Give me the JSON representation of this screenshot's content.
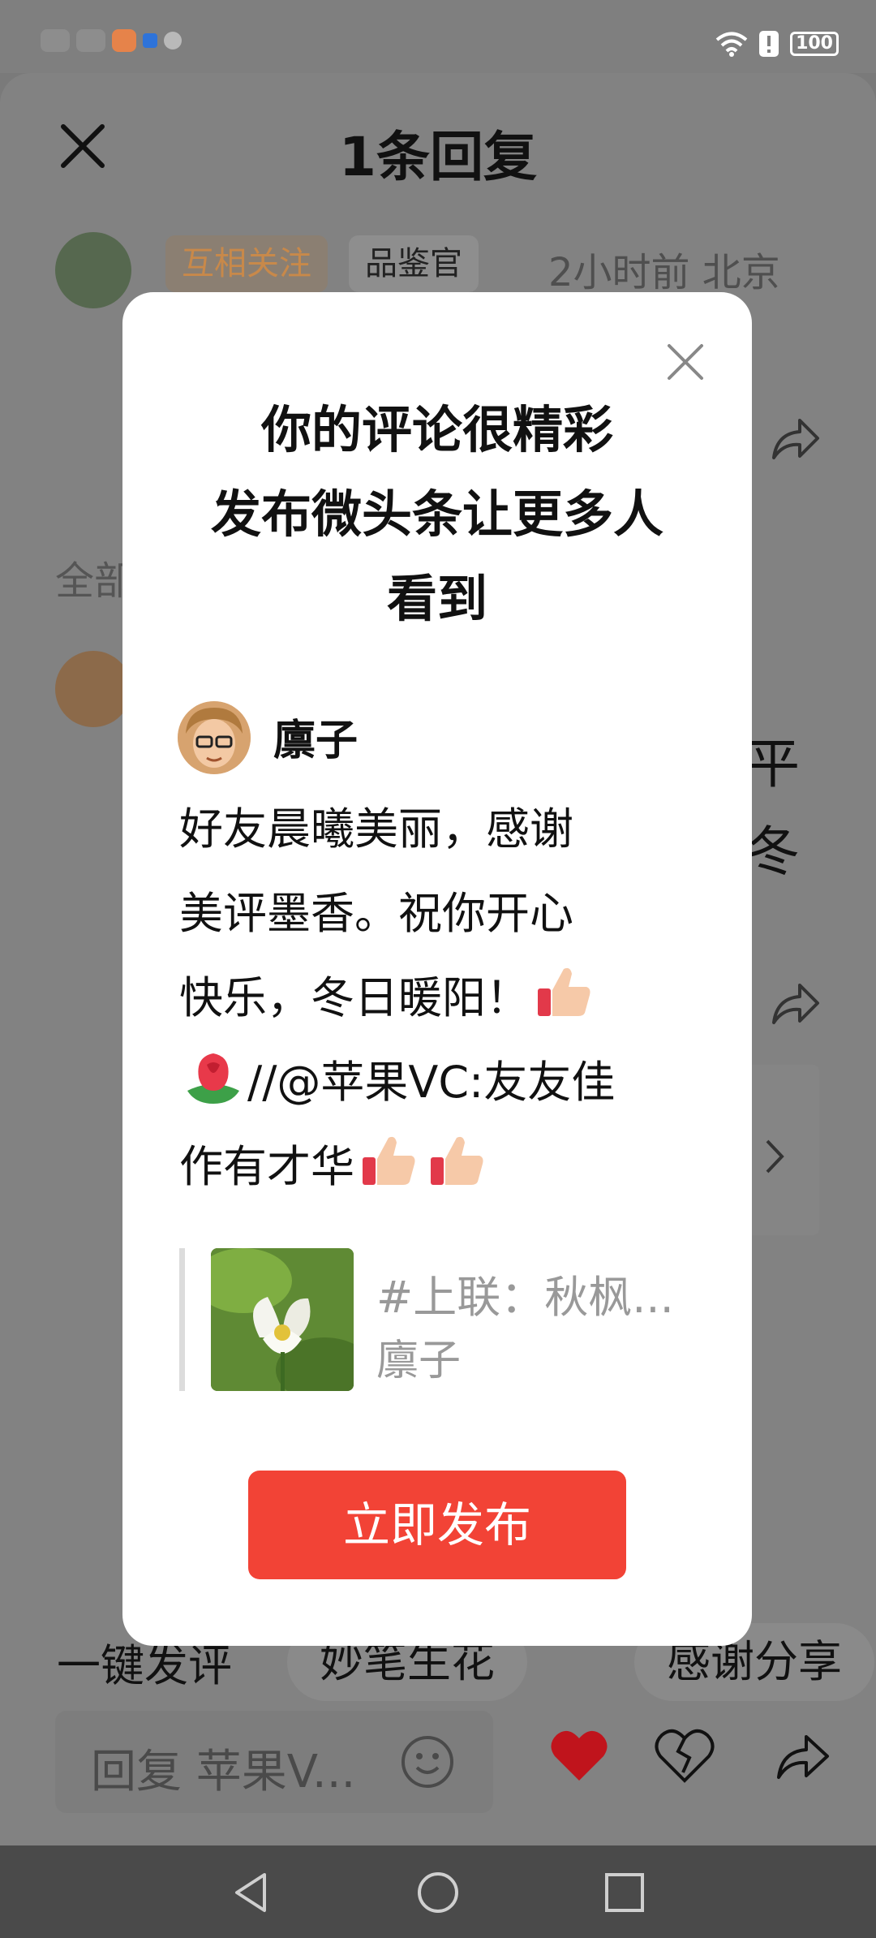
{
  "status_bar": {
    "battery": "100"
  },
  "sheet": {
    "title": "1条回复",
    "tags": [
      "互相关注",
      "品鉴官"
    ],
    "meta": "2小时前 北京",
    "all_label": "全部",
    "right_fragments": [
      "平",
      "冬"
    ]
  },
  "quick_chips": {
    "one_click": "一键发评",
    "chip1": "妙笔生花",
    "chip2": "感谢分享"
  },
  "bottom_bar": {
    "reply_placeholder": "回复 苹果V..."
  },
  "modal": {
    "title_lines": [
      "你的评论很精彩",
      "发布微头条让更多人",
      "看到"
    ],
    "author": "廪子",
    "body": {
      "line1": "好友晨曦美丽，感谢",
      "line2": "美评墨香。祝你开心",
      "line3": "快乐，冬日暖阳！",
      "line4": "//@苹果VC:友友佳",
      "line5": "作有才华"
    },
    "quote_title": "#上联：秋枫...",
    "quote_author": "廪子",
    "publish_button": "立即发布"
  },
  "icons": [
    "close-icon",
    "share-icon",
    "smile-icon",
    "heart-icon",
    "broken-heart-icon",
    "thumbs-up-icon",
    "rose-icon",
    "back-icon",
    "home-icon",
    "recent-apps-icon"
  ],
  "colors": {
    "accent": "#f24336",
    "heart": "#c0141c"
  }
}
